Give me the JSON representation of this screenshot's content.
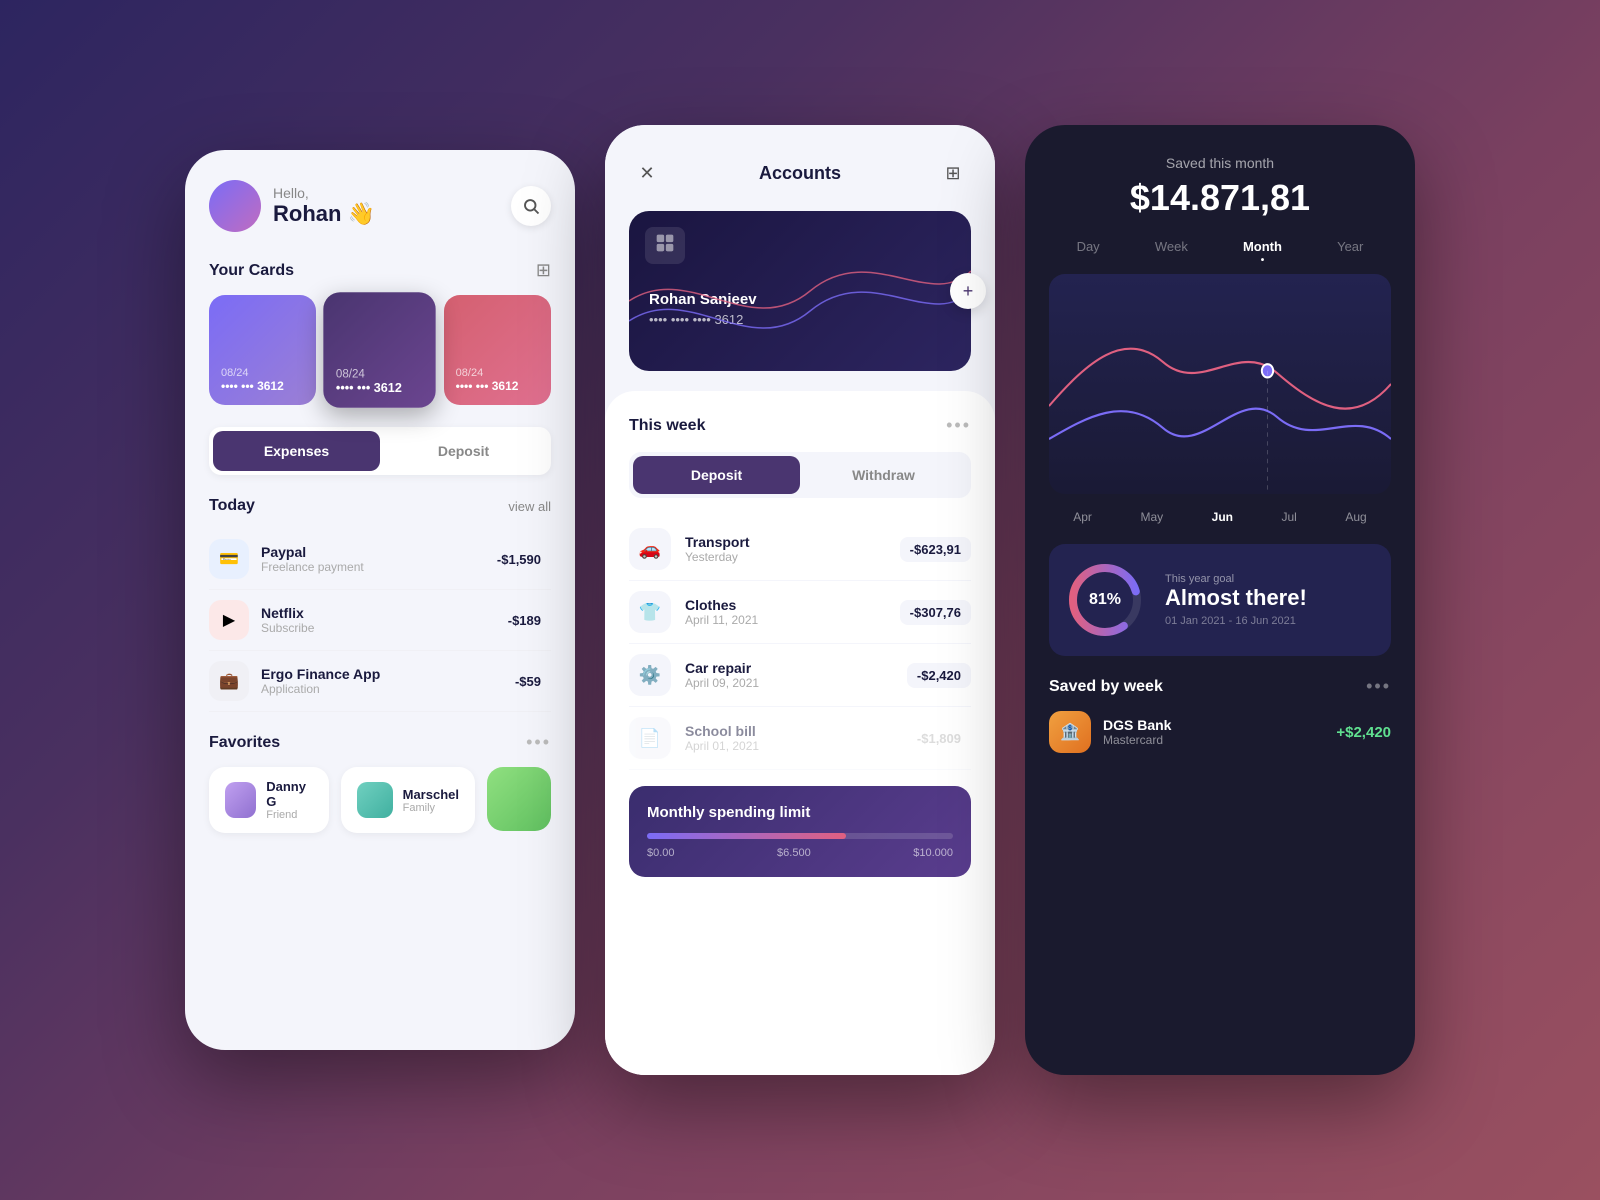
{
  "phone1": {
    "greeting": {
      "hello": "Hello,",
      "name": "Rohan 👋"
    },
    "cards_section": {
      "title": "Your Cards"
    },
    "cards": [
      {
        "date": "08/24",
        "num": "•••• ••• 3612",
        "style": "card1"
      },
      {
        "date": "08/24",
        "num": "•••• ••• 3612",
        "style": "card2"
      },
      {
        "date": "08/24",
        "num": "•••• ••• 3612",
        "style": "card3"
      }
    ],
    "tabs": {
      "active": "Expenses",
      "inactive": "Deposit"
    },
    "today": {
      "title": "Today",
      "view_all": "view all"
    },
    "transactions": [
      {
        "name": "Paypal",
        "sub": "Freelance payment",
        "amount": "-$1,590",
        "icon": "💳",
        "icon_style": "blue"
      },
      {
        "name": "Netflix",
        "sub": "Subscribe",
        "amount": "-$189",
        "icon": "▶",
        "icon_style": "pink"
      },
      {
        "name": "Ergo Finance App",
        "sub": "Application",
        "amount": "-$59",
        "icon": "💼",
        "icon_style": "gray"
      }
    ],
    "favorites": {
      "title": "Favorites",
      "items": [
        {
          "name": "Danny G",
          "rel": "Friend",
          "style": "purple"
        },
        {
          "name": "Marschel",
          "rel": "Family",
          "style": "teal"
        }
      ]
    }
  },
  "phone2": {
    "header": {
      "title": "Accounts"
    },
    "card": {
      "name": "Rohan Sanjeev",
      "num": "•••• •••• •••• 3612"
    },
    "this_week": "This week",
    "tabs": {
      "active": "Deposit",
      "inactive": "Withdraw"
    },
    "transactions": [
      {
        "name": "Transport",
        "date": "Yesterday",
        "amount": "-$623,91",
        "icon": "🚗",
        "faded": false
      },
      {
        "name": "Clothes",
        "date": "April 11, 2021",
        "amount": "-$307,76",
        "icon": "👕",
        "faded": false
      },
      {
        "name": "Car repair",
        "date": "April 09, 2021",
        "amount": "-$2,420",
        "icon": "⚙️",
        "faded": false
      },
      {
        "name": "School bill",
        "date": "April 01, 2021",
        "amount": "-$1,809",
        "icon": "📄",
        "faded": true
      }
    ],
    "spending_limit": {
      "title": "Monthly spending limit",
      "fill_percent": 65,
      "labels": [
        "$0.00",
        "$6.500",
        "$10.000"
      ]
    }
  },
  "phone3": {
    "saved_label": "Saved this month",
    "saved_amount": "$14.871,81",
    "time_tabs": [
      "Day",
      "Week",
      "Month",
      "Year"
    ],
    "active_tab": "Month",
    "months": [
      "Apr",
      "May",
      "Jun",
      "Jul",
      "Aug"
    ],
    "active_month": "Jun",
    "goal": {
      "percent": "81%",
      "label": "This year goal",
      "title": "Almost there!",
      "date": "01 Jan 2021 - 16 Jun 2021"
    },
    "saved_week_title": "Saved by week",
    "bank": {
      "name": "DGS Bank",
      "sub": "Mastercard",
      "amount": "+$2,420"
    }
  }
}
